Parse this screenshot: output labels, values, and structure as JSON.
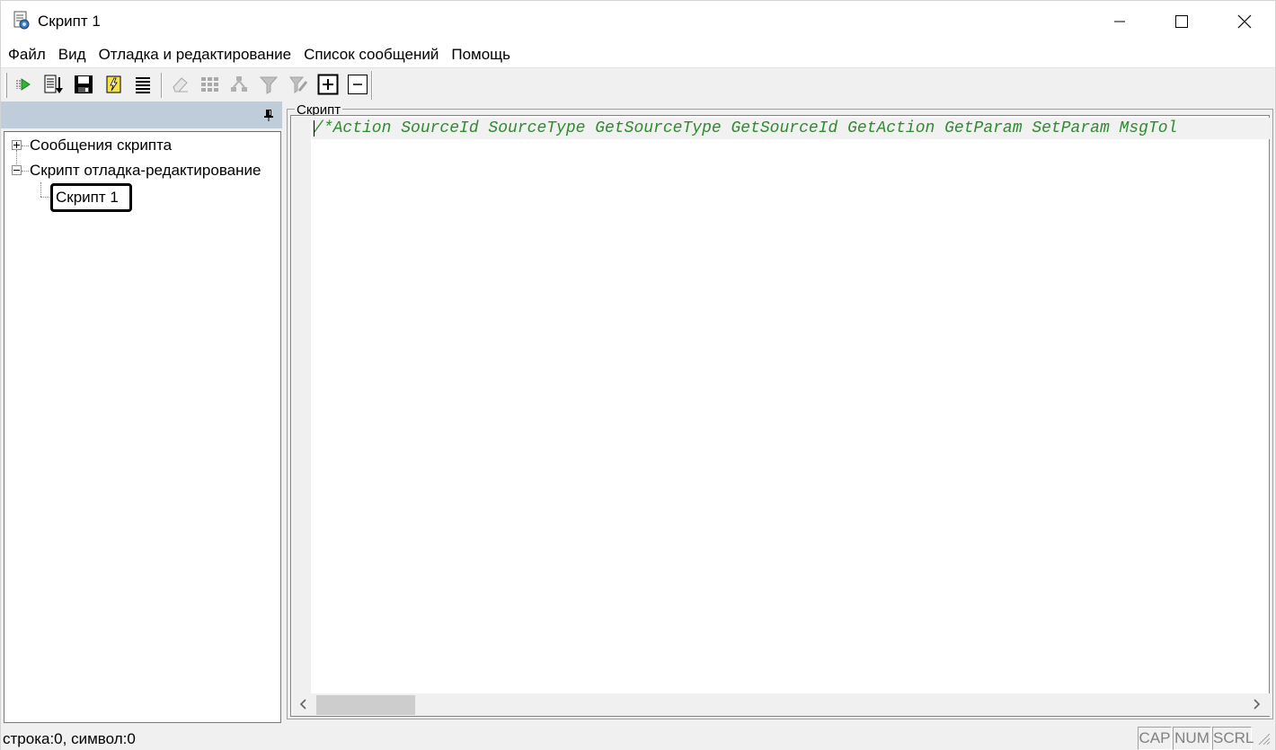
{
  "window": {
    "title": "Скрипт 1"
  },
  "menu": {
    "items": [
      "Файл",
      "Вид",
      "Отладка и редактирование",
      "Список сообщений",
      "Помощь"
    ]
  },
  "toolbar": {
    "buttons": [
      {
        "icon": "run-icon",
        "enabled": true
      },
      {
        "icon": "step-into-icon",
        "enabled": true
      },
      {
        "icon": "save-icon",
        "enabled": true
      },
      {
        "icon": "compile-icon",
        "enabled": true
      },
      {
        "icon": "list-icon",
        "enabled": true
      },
      {
        "icon": "eraser-icon",
        "enabled": false
      },
      {
        "icon": "grid-icon",
        "enabled": false
      },
      {
        "icon": "tree-nodes-icon",
        "enabled": false
      },
      {
        "icon": "filter-icon",
        "enabled": false
      },
      {
        "icon": "filter-edit-icon",
        "enabled": false
      },
      {
        "icon": "expand-all-icon",
        "enabled": true
      },
      {
        "icon": "collapse-all-icon",
        "enabled": true
      }
    ]
  },
  "tree": {
    "nodes": [
      {
        "label": "Сообщения скрипта",
        "expanded": false
      },
      {
        "label": "Скрипт отладка-редактирование",
        "expanded": true
      },
      {
        "label": "Скрипт 1",
        "selected": true
      }
    ]
  },
  "editor": {
    "group_label": "Скрипт",
    "line1": "/*Action SourceId SourceType GetSourceType GetSourceId GetAction GetParam SetParam MsgTol",
    "code_color": "#2e8b2e"
  },
  "status": {
    "text": "строка:0, символ:0",
    "indicators": [
      "CAP",
      "NUM",
      "SCRL"
    ]
  }
}
